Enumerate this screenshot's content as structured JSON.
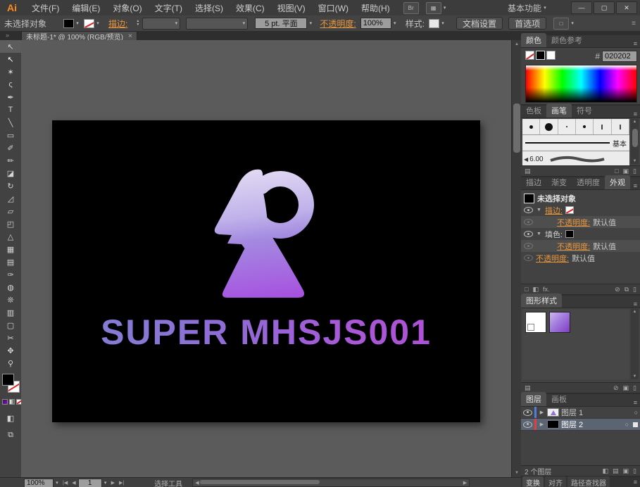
{
  "window": {
    "workspace_switcher": "基本功能",
    "minimize": "—",
    "restore": "▢",
    "close": "✕"
  },
  "menubar": {
    "logo": "Ai",
    "menus": [
      "文件(F)",
      "编辑(E)",
      "对象(O)",
      "文字(T)",
      "选择(S)",
      "效果(C)",
      "视图(V)",
      "窗口(W)",
      "帮助(H)"
    ],
    "bridge_icon": "Br",
    "arrange_documents_icon": "▦"
  },
  "controlbar": {
    "no_selection_label": "未选择对象",
    "stroke_label": "描边:",
    "brush_definition": "5 pt. 平面",
    "opacity_label": "不透明度:",
    "opacity_value": "100%",
    "style_label": "样式:",
    "document_setup_button": "文档设置",
    "preferences_button": "首选项"
  },
  "document_tab": {
    "title": "未标题-1* @ 100% (RGB/预览)",
    "close": "×"
  },
  "icons": {
    "dropdown": "▾",
    "up": "▲",
    "down": "▼",
    "right": "▶",
    "left": "◀",
    "expand_down": "▼",
    "expand_right": "▶",
    "panel_menu": "≡",
    "chevrons": "»",
    "fx": "fx.",
    "new_item": "▣",
    "delete_item": "▯",
    "library": "▤",
    "clear": "⊘",
    "duplicate": "⧉",
    "mask": "◧",
    "square": "□",
    "speaker": "◀",
    "first": "|◀",
    "prev": "◀",
    "next": "▶",
    "last": "▶|"
  },
  "tools": [
    {
      "name": "selection-tool",
      "glyph": "↖"
    },
    {
      "name": "direct-selection-tool",
      "glyph": "↖"
    },
    {
      "name": "magic-wand-tool",
      "glyph": "✶"
    },
    {
      "name": "lasso-tool",
      "glyph": "ς"
    },
    {
      "name": "pen-tool",
      "glyph": "✒"
    },
    {
      "name": "type-tool",
      "glyph": "T"
    },
    {
      "name": "line-segment-tool",
      "glyph": "╲"
    },
    {
      "name": "rectangle-tool",
      "glyph": "▭"
    },
    {
      "name": "paintbrush-tool",
      "glyph": "✐"
    },
    {
      "name": "pencil-tool",
      "glyph": "✏"
    },
    {
      "name": "eraser-tool",
      "glyph": "◪"
    },
    {
      "name": "rotate-tool",
      "glyph": "↻"
    },
    {
      "name": "scale-tool",
      "glyph": "◿"
    },
    {
      "name": "free-transform-tool",
      "glyph": "▱"
    },
    {
      "name": "shape-builder-tool",
      "glyph": "◰"
    },
    {
      "name": "perspective-grid-tool",
      "glyph": "△"
    },
    {
      "name": "mesh-tool",
      "glyph": "▦"
    },
    {
      "name": "gradient-tool",
      "glyph": "▤"
    },
    {
      "name": "eyedropper-tool",
      "glyph": "✑"
    },
    {
      "name": "blend-tool",
      "glyph": "◍"
    },
    {
      "name": "symbol-sprayer-tool",
      "glyph": "❊"
    },
    {
      "name": "column-graph-tool",
      "glyph": "▥"
    },
    {
      "name": "artboard-tool",
      "glyph": "▢"
    },
    {
      "name": "slice-tool",
      "glyph": "✂"
    },
    {
      "name": "hand-tool",
      "glyph": "✥"
    },
    {
      "name": "zoom-tool",
      "glyph": "⚲"
    }
  ],
  "artboard": {
    "logo_text": "SUPER MHSJS001",
    "background": "#000000",
    "gradient_top": "#e6e0f5",
    "gradient_bottom": "#a74fe0"
  },
  "color_panel": {
    "tabs": [
      "颜色",
      "颜色参考"
    ],
    "hash": "#",
    "hex_value": "020202"
  },
  "brushes_panel": {
    "tabs": [
      "色板",
      "画笔",
      "符号"
    ],
    "basic_brush_label": "基本",
    "charcoal_size": "6.00"
  },
  "appearance_panel": {
    "tabs": [
      "描边",
      "渐变",
      "透明度",
      "外观"
    ],
    "no_selection": "未选择对象",
    "stroke_label": "描边:",
    "fill_label": "填色:",
    "opacity_label": "不透明度:",
    "default_value": "默认值"
  },
  "graphic_styles_panel": {
    "title": "图形样式"
  },
  "layers_panel": {
    "tabs": [
      "图层",
      "画板"
    ],
    "layers": [
      {
        "name": "图层 1",
        "color": "#4f7fd9"
      },
      {
        "name": "图层 2",
        "color": "#e04040"
      }
    ],
    "count": "2 个图层"
  },
  "bottom_tabs": [
    "变换",
    "对齐",
    "路径查找器"
  ],
  "statusbar": {
    "zoom_value": "100%",
    "artboard_number": "1",
    "status_text": "选择工具"
  }
}
